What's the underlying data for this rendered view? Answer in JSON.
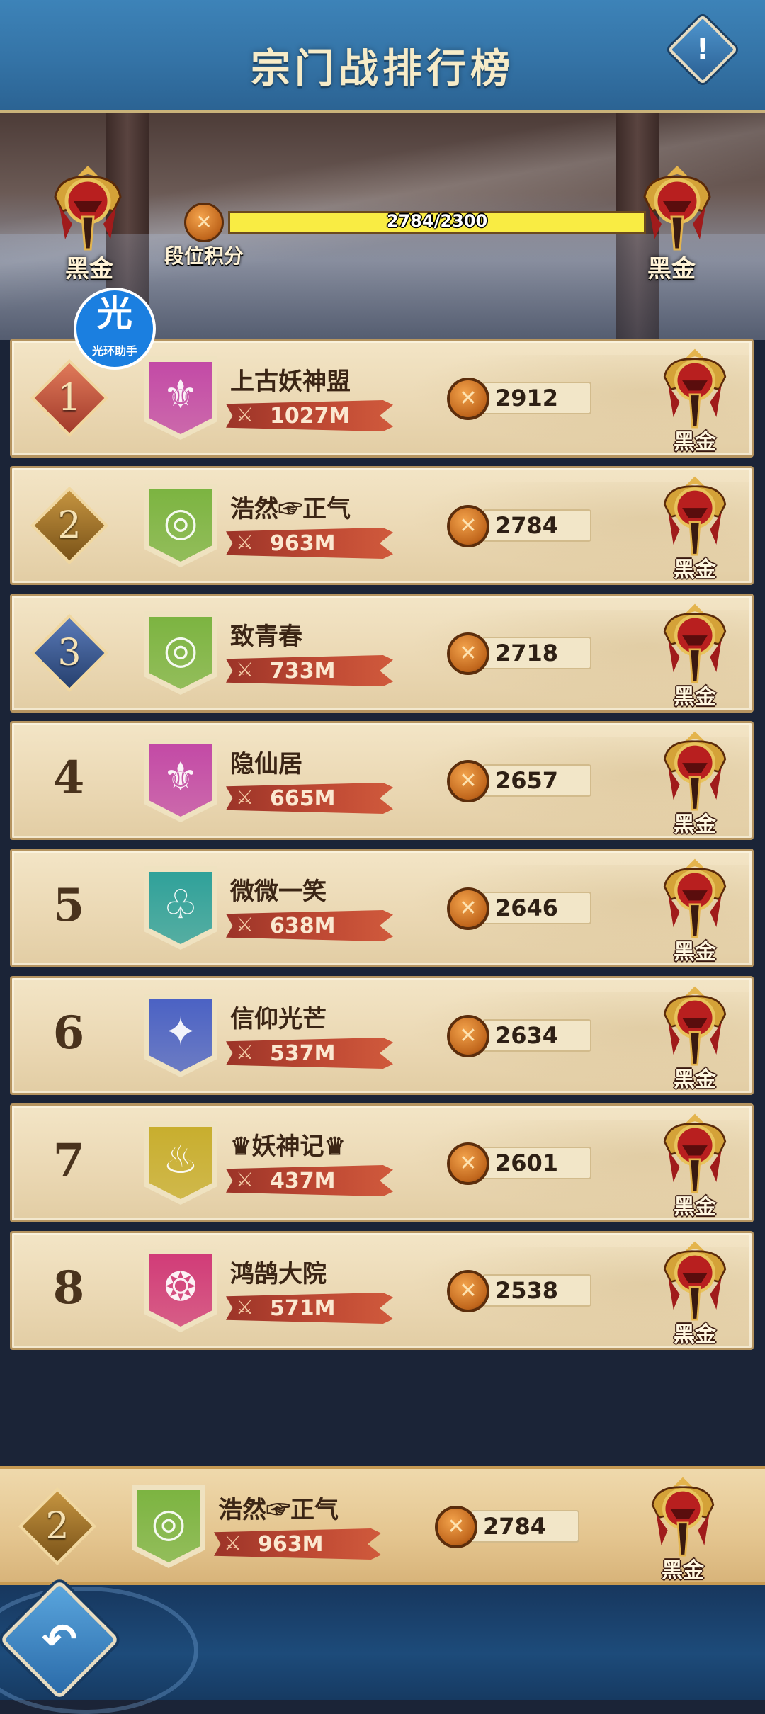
{
  "header": {
    "title": "宗门战排行榜",
    "info_glyph": "!"
  },
  "banner": {
    "left_tier": "黑金",
    "right_tier": "黑金",
    "points_label": "段位积分",
    "progress_text": "2784/2300",
    "progress_fraction": 1.0,
    "helper": {
      "char": "光",
      "label": "光环助手"
    }
  },
  "rows": [
    {
      "rank": "1",
      "rank_style": "gold",
      "name": "上古妖神盟",
      "power": "1027M",
      "score": "2912",
      "tier": "黑金",
      "emblem_color": "#c34aa6",
      "emblem_glyph": "⚜"
    },
    {
      "rank": "2",
      "rank_style": "silver",
      "name": "浩然☞正气",
      "power": "963M",
      "score": "2784",
      "tier": "黑金",
      "emblem_color": "#7cb441",
      "emblem_glyph": "◎"
    },
    {
      "rank": "3",
      "rank_style": "bronze",
      "name": "致青春",
      "power": "733M",
      "score": "2718",
      "tier": "黑金",
      "emblem_color": "#7cb441",
      "emblem_glyph": "◎"
    },
    {
      "rank": "4",
      "rank_style": "plain",
      "name": "隐仙居",
      "power": "665M",
      "score": "2657",
      "tier": "黑金",
      "emblem_color": "#c34aa6",
      "emblem_glyph": "⚜"
    },
    {
      "rank": "5",
      "rank_style": "plain",
      "name": "微微一笑",
      "power": "638M",
      "score": "2646",
      "tier": "黑金",
      "emblem_color": "#2fa19a",
      "emblem_glyph": "♧"
    },
    {
      "rank": "6",
      "rank_style": "plain",
      "name": "信仰光芒",
      "power": "537M",
      "score": "2634",
      "tier": "黑金",
      "emblem_color": "#4b62c4",
      "emblem_glyph": "✦"
    },
    {
      "rank": "7",
      "rank_style": "plain",
      "name": "♛妖神记♛",
      "power": "437M",
      "score": "2601",
      "tier": "黑金",
      "emblem_color": "#c8ae2e",
      "emblem_glyph": "♨"
    },
    {
      "rank": "8",
      "rank_style": "plain",
      "name": "鸿鹄大院",
      "power": "571M",
      "score": "2538",
      "tier": "黑金",
      "emblem_color": "#d13c78",
      "emblem_glyph": "❂"
    }
  ],
  "my_row": {
    "rank": "2",
    "rank_style": "silver",
    "name": "浩然☞正气",
    "power": "963M",
    "score": "2784",
    "tier": "黑金",
    "emblem_color": "#7cb441",
    "emblem_glyph": "◎"
  },
  "footer": {
    "back_glyph": "↶"
  },
  "icons": {
    "power": "crossed-swords-icon",
    "score": "crossed-swords-medal-icon",
    "tier": "black-gold-helmet-badge-icon",
    "info": "info-icon",
    "back": "back-arrow-icon"
  }
}
